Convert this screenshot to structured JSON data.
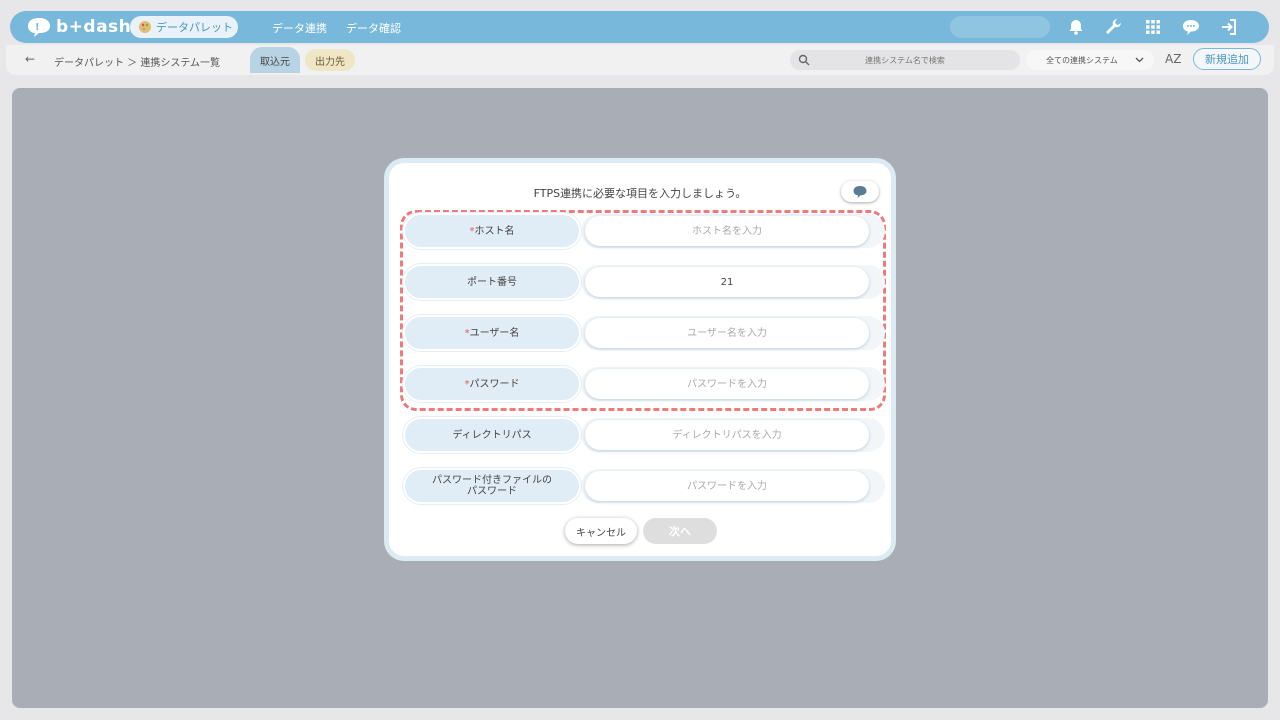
{
  "header": {
    "logo_text": "b+dash",
    "palette_label": "データパレット",
    "nav": [
      "データ連携",
      "データ確認"
    ]
  },
  "subheader": {
    "back_icon": "←",
    "breadcrumb": "データパレット ＞ 連携システム一覧",
    "tab_source": "取込元",
    "tab_output": "出力先",
    "search_placeholder": "連携システム名で検索",
    "filter_selected": "全ての連携システム",
    "sort_icon": "AZ",
    "new_button": "新規追加"
  },
  "modal": {
    "title": "FTPS連携に必要な項目を入力しましょう。",
    "fields": [
      {
        "label": "ホスト名",
        "required": "*",
        "value": "",
        "placeholder": "ホスト名を入力"
      },
      {
        "label": "ポート番号",
        "required": "",
        "value": "21",
        "placeholder": ""
      },
      {
        "label": "ユーザー名",
        "required": "*",
        "value": "",
        "placeholder": "ユーザー名を入力"
      },
      {
        "label": "パスワード",
        "required": "*",
        "value": "",
        "placeholder": "パスワードを入力"
      },
      {
        "label": "ディレクトリパス",
        "required": "",
        "value": "",
        "placeholder": "ディレクトリパスを入力"
      },
      {
        "label": "パスワード付きファイルの\nパスワード",
        "required": "",
        "value": "",
        "placeholder": "パスワードを入力"
      }
    ],
    "cancel_label": "キャンセル",
    "next_label": "次へ"
  },
  "colors": {
    "accent": "#78b9db",
    "highlight_dash": "#ee7a7a",
    "label_bg": "#e0ecf6"
  }
}
